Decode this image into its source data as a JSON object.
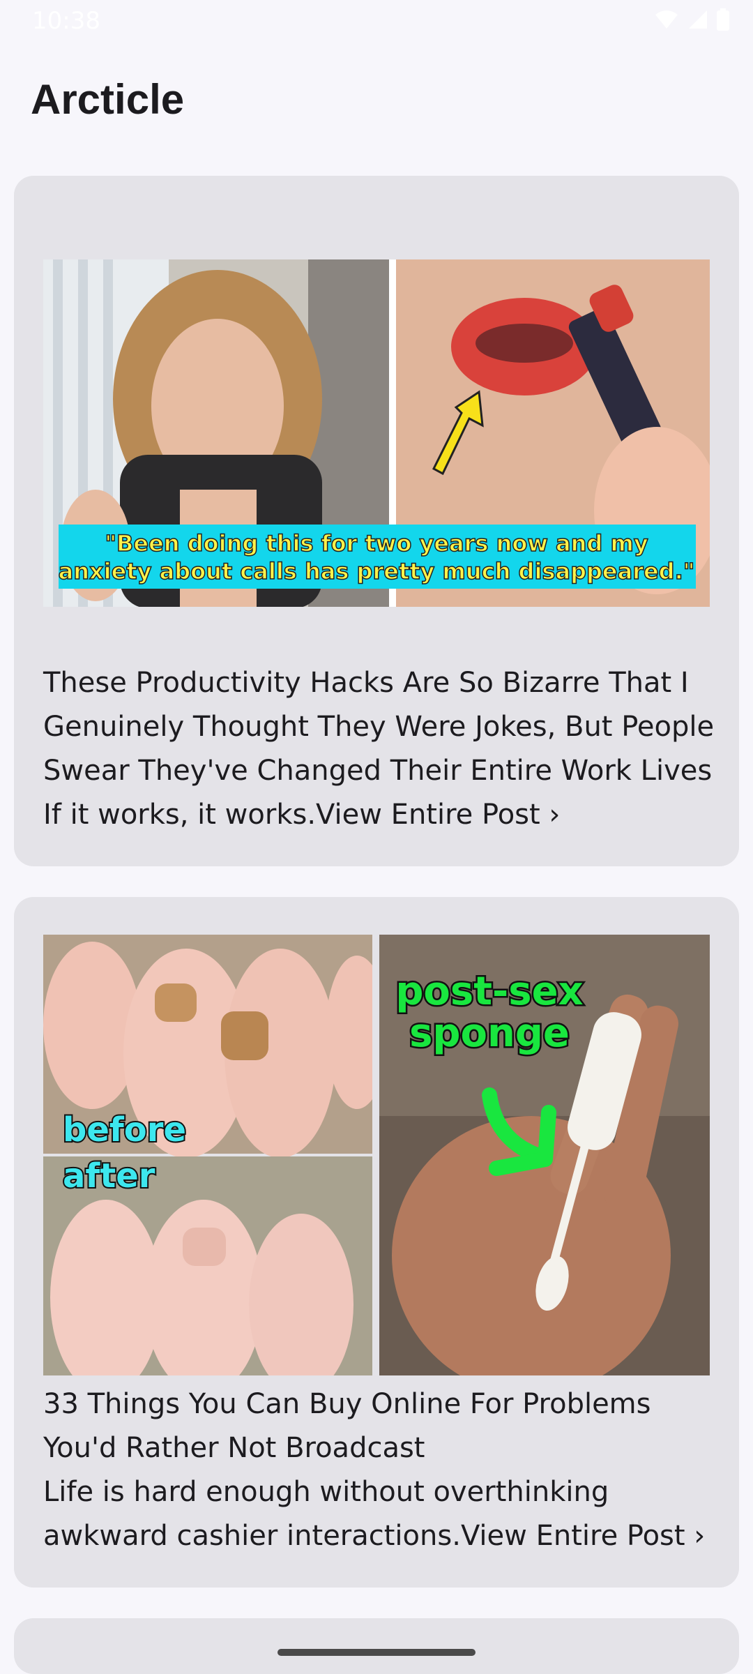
{
  "status_bar": {
    "time": "10:38"
  },
  "header": {
    "title": "Arcticle"
  },
  "articles": [
    {
      "image_caption": "\"Been doing this for two years now and my anxiety about calls has pretty much disappeared.\"",
      "title": "These Productivity Hacks Are So Bizarre That I Genuinely Thought They Were Jokes, But People Swear They've Changed Their Entire Work Lives",
      "description": "If it works, it works.",
      "link_label": "View Entire Post ›"
    },
    {
      "image_labels": [
        "before",
        "after",
        "post-sex sponge"
      ],
      "title": "33 Things You Can Buy Online For Problems You'd Rather Not Broadcast",
      "description": "Life is hard enough without overthinking awkward cashier interactions.",
      "link_label": "View Entire Post ›"
    }
  ],
  "colors": {
    "background": "#f7f6fb",
    "card": "#e4e3e8",
    "caption_bg": "#13d6ec",
    "caption_text": "#fff34a",
    "green_label": "#19e63f"
  }
}
